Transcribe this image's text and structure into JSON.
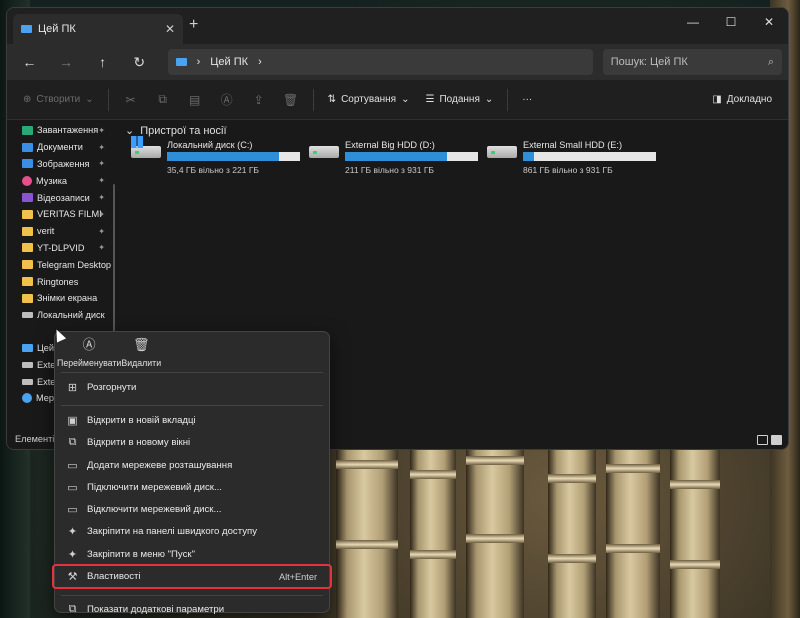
{
  "window": {
    "tab_title": "Цей ПК",
    "tab_close": "✕",
    "new_tab": "+",
    "caption": {
      "minimize": "—",
      "maximize": "☐",
      "close": "✕"
    }
  },
  "nav": {
    "back": "←",
    "forward": "→",
    "up": "↑",
    "refresh": "↻",
    "address_sep": "›",
    "address": "Цей ПК",
    "address_chevron": "›",
    "search_placeholder": "Пошук: Цей ПК",
    "search_icon": "⌕"
  },
  "toolbar": {
    "new_label": "Створити",
    "sort_label": "Сортування",
    "view_label": "Подання",
    "more_label": "···",
    "details_label": "Докладно"
  },
  "sidebar": {
    "items": [
      {
        "label": "Завантаження",
        "icon": "download-icon",
        "pinned": true
      },
      {
        "label": "Документи",
        "icon": "document-icon",
        "pinned": true
      },
      {
        "label": "Зображення",
        "icon": "pictures-icon",
        "pinned": true
      },
      {
        "label": "Музика",
        "icon": "music-icon",
        "pinned": true
      },
      {
        "label": "Відеозаписи",
        "icon": "video-icon",
        "pinned": true
      },
      {
        "label": "VERITAS FILMI",
        "icon": "folder-icon",
        "pinned": true
      },
      {
        "label": "verit",
        "icon": "folder-icon",
        "pinned": true
      },
      {
        "label": "YT-DLPVID",
        "icon": "folder-icon",
        "pinned": true
      },
      {
        "label": "Telegram Desktop",
        "icon": "folder-icon",
        "pinned": false
      },
      {
        "label": "Ringtones",
        "icon": "folder-icon",
        "pinned": false
      },
      {
        "label": "Знімки екрана",
        "icon": "folder-icon",
        "pinned": false
      },
      {
        "label": "Локальний диск",
        "icon": "drive-icon",
        "pinned": false
      }
    ],
    "pin_glyph": "✦",
    "bottom_items": [
      {
        "label": "Цей ПК",
        "icon": "monitor-icon"
      },
      {
        "label": "Exte",
        "icon": "drive-icon"
      },
      {
        "label": "Exte",
        "icon": "drive-icon"
      },
      {
        "label": "Мер",
        "icon": "network-icon"
      }
    ]
  },
  "content": {
    "section_title": "Пристрої та носії",
    "section_chevron": "⌄",
    "drives": [
      {
        "name": "Локальний диск (C:)",
        "free": "35,4 ГБ вільно з 221 ГБ",
        "used_fraction": 0.84,
        "system": true
      },
      {
        "name": "External Big HDD (D:)",
        "free": "211 ГБ вільно з 931 ГБ",
        "used_fraction": 0.77,
        "system": false
      },
      {
        "name": "External Small HDD (E:)",
        "free": "861 ГБ вільно з 931 ГБ",
        "used_fraction": 0.08,
        "system": false
      }
    ]
  },
  "status": {
    "items_label": "Елементів:"
  },
  "context_menu": {
    "quick_actions": [
      {
        "label": "Перейменувати",
        "icon": "rename-icon"
      },
      {
        "label": "Видалити",
        "icon": "trash-icon"
      }
    ],
    "items": [
      {
        "label": "Розгорнути",
        "icon": "expand-icon"
      },
      {
        "label": "Відкрити в новій вкладці",
        "icon": "new-tab-icon"
      },
      {
        "label": "Відкрити в новому вікні",
        "icon": "new-window-icon"
      },
      {
        "label": "Додати мережеве розташування",
        "icon": "network-location-icon"
      },
      {
        "label": "Підключити мережевий диск...",
        "icon": "map-drive-icon"
      },
      {
        "label": "Відключити мережевий диск...",
        "icon": "disconnect-drive-icon"
      },
      {
        "label": "Закріпити на панелі швидкого доступу",
        "icon": "pin-icon"
      },
      {
        "label": "Закріпити в меню \"Пуск\"",
        "icon": "pin-start-icon"
      },
      {
        "label": "Властивості",
        "icon": "wrench-icon",
        "shortcut": "Alt+Enter",
        "highlighted": true
      },
      {
        "label": "Показати додаткові параметри",
        "icon": "more-options-icon"
      }
    ]
  },
  "colors": {
    "accent": "#2e8fd8",
    "highlight_border": "#e5323c",
    "menu_bg": "#2b2b2b",
    "window_bg": "#191919"
  }
}
